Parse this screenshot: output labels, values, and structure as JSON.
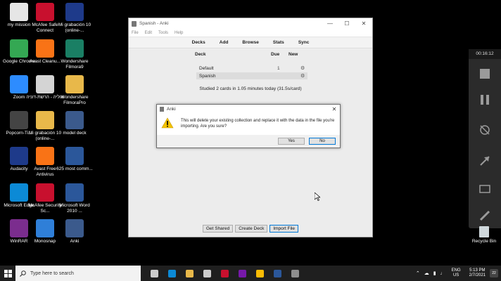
{
  "desktop": {
    "icons": [
      {
        "label": "my mission",
        "color": "#e6e6e6"
      },
      {
        "label": "McAfee Safe Connect",
        "color": "#c8102e"
      },
      {
        "label": "Mi grabación 10 (online-...",
        "color": "#1e3a8a"
      },
      {
        "label": "Google Chrome",
        "color": "#34a853"
      },
      {
        "label": "Avast Cleanu...",
        "color": "#f97316"
      },
      {
        "label": "Wondershare Filmora9",
        "color": "#1a7f64"
      },
      {
        "label": "Zoom",
        "color": "#2d8cff"
      },
      {
        "label": "אוליה - הרשת-דוניה",
        "color": "#d4d4d4"
      },
      {
        "label": "Wondershare FilmoraPro",
        "color": "#e8b84a"
      },
      {
        "label": "Popcorn-Ti...",
        "color": "#444444"
      },
      {
        "label": "Mi grabación 10 (online-...",
        "color": "#e8b84a"
      },
      {
        "label": "model deck",
        "color": "#3b5a8c"
      },
      {
        "label": "Audacity",
        "color": "#1e3a8a"
      },
      {
        "label": "Avast Free Antivirus",
        "color": "#f97316"
      },
      {
        "label": "625 most comm...",
        "color": "#2b579a"
      },
      {
        "label": "Microsoft Edge",
        "color": "#0c8ad6"
      },
      {
        "label": "McAfee Security Sc...",
        "color": "#c8102e"
      },
      {
        "label": "Microsoft Word 2010 ...",
        "color": "#2b579a"
      },
      {
        "label": "WinRAR",
        "color": "#7b2d8e"
      },
      {
        "label": "Monosnap",
        "color": "#2f7fd8"
      },
      {
        "label": "Anki",
        "color": "#3b5a8c"
      }
    ],
    "recycle_label": "Recycle Bin"
  },
  "anki": {
    "title": "Spanish - Anki",
    "menu": [
      "File",
      "Edit",
      "Tools",
      "Help"
    ],
    "toolbar": [
      "Decks",
      "Add",
      "Browse",
      "Stats",
      "Sync"
    ],
    "columns": {
      "deck": "Deck",
      "due": "Due",
      "new": "New"
    },
    "decks": [
      {
        "name": "Default",
        "due": "1",
        "selected": false
      },
      {
        "name": "Spanish",
        "due": "",
        "selected": true
      }
    ],
    "studied": "Studied 2 cards in 1.05 minutes today (31.5s/card)",
    "buttons": {
      "get_shared": "Get Shared",
      "create_deck": "Create Deck",
      "import_file": "Import File"
    }
  },
  "dialog": {
    "title": "Anki",
    "message": "This will delete your existing collection and replace it with the data in the file you're importing. Are you sure?",
    "yes": "Yes",
    "no": "No"
  },
  "recording": {
    "time": "00:16:12"
  },
  "taskbar": {
    "search_placeholder": "Type here to search",
    "lang_top": "ENG",
    "lang_bottom": "US",
    "time": "5:13 PM",
    "date": "2/7/2021",
    "notifications": "22",
    "pinned": [
      {
        "name": "task-view-icon",
        "color": "#cccccc"
      },
      {
        "name": "edge-icon",
        "color": "#0c8ad6"
      },
      {
        "name": "file-explorer-icon",
        "color": "#e8b84a"
      },
      {
        "name": "store-icon",
        "color": "#cccccc"
      },
      {
        "name": "mcafee-icon",
        "color": "#c8102e"
      },
      {
        "name": "onenote-icon",
        "color": "#7719aa"
      },
      {
        "name": "chrome-icon",
        "color": "#fbbc05"
      },
      {
        "name": "word-icon",
        "color": "#2b579a"
      },
      {
        "name": "anki-icon",
        "color": "#8e8e8e"
      }
    ]
  }
}
